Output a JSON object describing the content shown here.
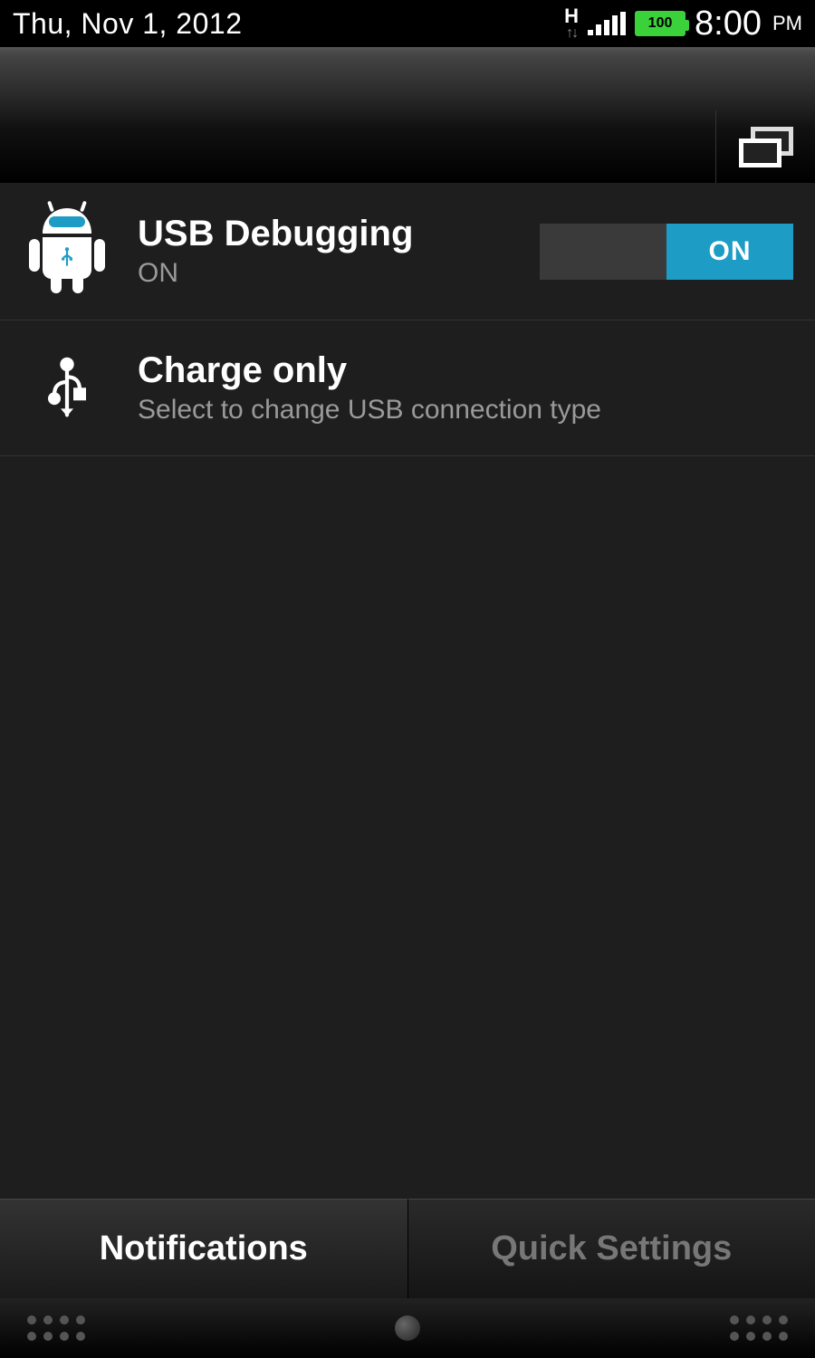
{
  "status": {
    "date": "Thu, Nov 1, 2012",
    "network_type": "H",
    "battery_level": "100",
    "time": "8:00",
    "ampm": "PM"
  },
  "notifications": [
    {
      "title": "USB Debugging",
      "subtitle": "ON",
      "toggle_label": "ON"
    },
    {
      "title": "Charge only",
      "subtitle": "Select to change USB connection type"
    }
  ],
  "tabs": {
    "notifications": "Notifications",
    "quick_settings": "Quick Settings"
  }
}
